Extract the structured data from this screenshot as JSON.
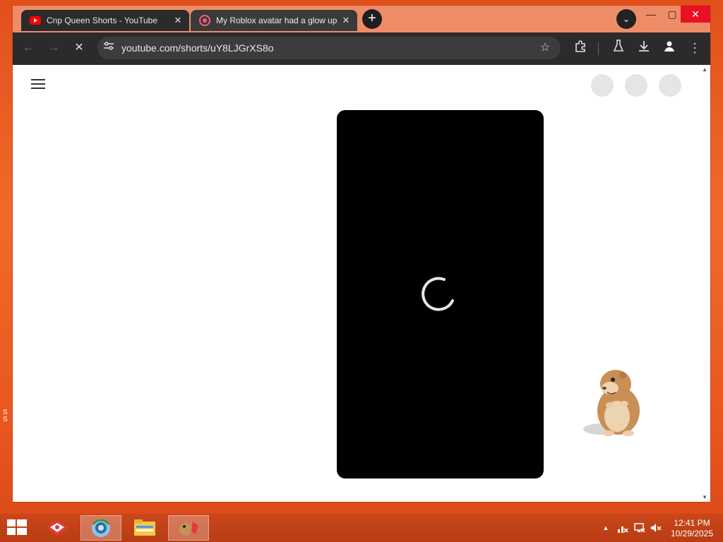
{
  "browser": {
    "tabs": [
      {
        "title": "Cnp Queen Shorts - YouTube",
        "favicon": "youtube-icon",
        "active": true
      },
      {
        "title": "My Roblox avatar had a glow up",
        "favicon": "audio-playing-icon",
        "active": false
      }
    ],
    "new_tab_label": "+",
    "address_bar": {
      "url": "youtube.com/shorts/uY8LJGrXS8o",
      "site_icon": "site-settings-icon"
    },
    "toolbar_icons": [
      "back-icon",
      "forward-icon",
      "stop-loading-icon",
      "bookmark-star-icon",
      "extensions-icon",
      "labs-icon",
      "download-icon",
      "profile-icon",
      "menu-icon"
    ]
  },
  "page": {
    "state": "loading",
    "menu_icon": "hamburger-icon",
    "header_placeholders": 3,
    "player_background": "#000000"
  },
  "taskbar": {
    "apps": [
      "start-icon",
      "gift-icon",
      "chrome-icon",
      "file-explorer-icon",
      "hamster-app-icon"
    ],
    "tray_icons": [
      "show-hidden-icons",
      "network-icon",
      "display-icon",
      "volume-muted-icon"
    ],
    "time": "12:41 PM",
    "date": "10/29/2025"
  },
  "colors": {
    "desktop": "#e8561f",
    "tab_active": "#2b2b2b",
    "toolbar": "#2b2b2b",
    "close_button": "#e81123"
  }
}
